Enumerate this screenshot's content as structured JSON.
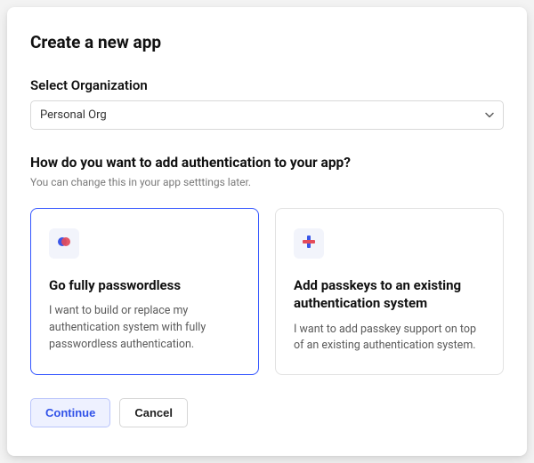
{
  "modal": {
    "title": "Create a new app",
    "org_label": "Select Organization",
    "org_value": "Personal Org",
    "question": "How do you want to add authentication to your app?",
    "helper": "You can change this in your app setttings later.",
    "options": [
      {
        "title": "Go fully passwordless",
        "desc": "I want to build or replace my authentication system with fully passwordless authentication.",
        "selected": true,
        "icon": "circles-icon"
      },
      {
        "title": "Add passkeys to an existing authentication system",
        "desc": "I want to add passkey support on top of an existing authentication system.",
        "selected": false,
        "icon": "plus-icon"
      }
    ],
    "continue_label": "Continue",
    "cancel_label": "Cancel"
  }
}
